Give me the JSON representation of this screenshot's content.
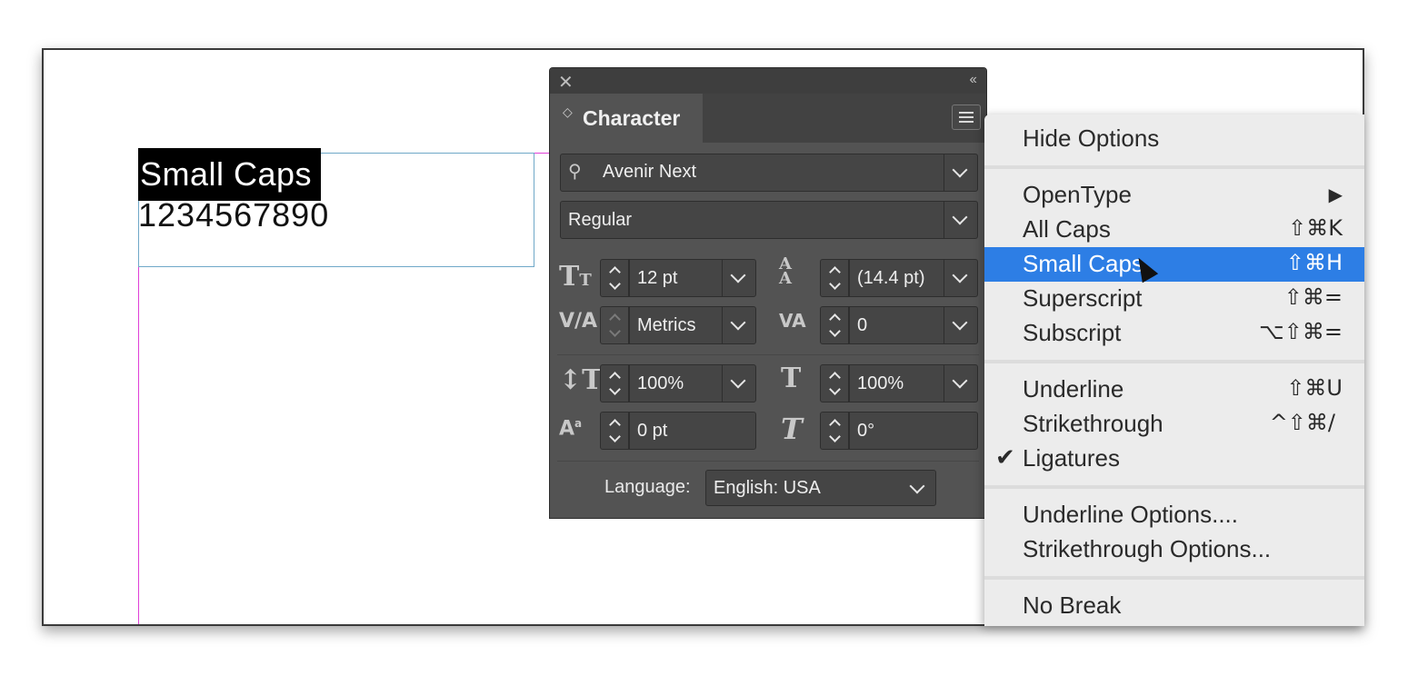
{
  "document": {
    "line1": "Small Caps",
    "line2": "1234567890"
  },
  "panel": {
    "close_icon": "close-icon",
    "collapse_icon": "collapse-icon",
    "tab_title": "Character",
    "font_family": "Avenir Next",
    "font_style": "Regular",
    "font_size": "12 pt",
    "leading": "(14.4 pt)",
    "kerning": "Metrics",
    "tracking": "0",
    "vertical_scale": "100%",
    "horizontal_scale": "100%",
    "baseline_shift": "0 pt",
    "skew": "0°",
    "language_label": "Language:",
    "language": "English: USA"
  },
  "menu": {
    "hide_options": "Hide Options",
    "opentype": "OpenType",
    "all_caps": "All Caps",
    "all_caps_sc": "⇧⌘K",
    "small_caps": "Small Caps",
    "small_caps_sc": "⇧⌘H",
    "superscript": "Superscript",
    "superscript_sc": "⇧⌘=",
    "subscript": "Subscript",
    "subscript_sc": "⌥⇧⌘=",
    "underline": "Underline",
    "underline_sc": "⇧⌘U",
    "strikethrough": "Strikethrough",
    "strikethrough_sc": "^⇧⌘/",
    "ligatures": "Ligatures",
    "underline_options": "Underline Options....",
    "strikethrough_options": "Strikethrough Options...",
    "no_break": "No Break"
  },
  "colors": {
    "selection": "#2d7ee5",
    "panel_bg": "#535353",
    "menu_bg": "#ececec",
    "margin_guide": "#e040d8"
  }
}
